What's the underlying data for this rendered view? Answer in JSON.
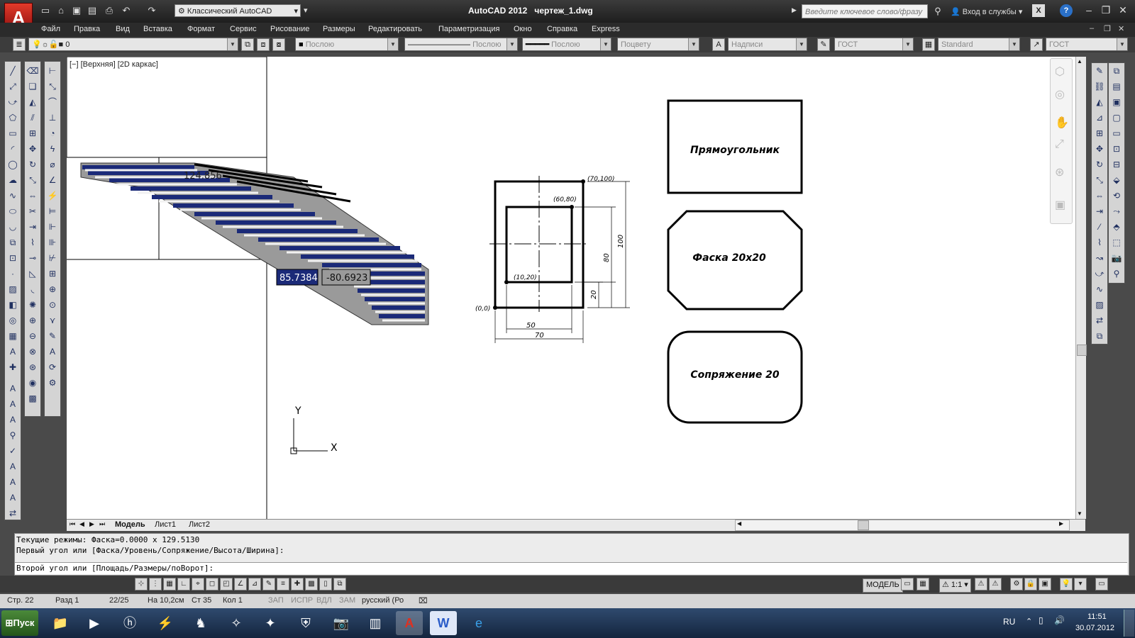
{
  "window": {
    "app_icon": "A",
    "workspace": "Классический AutoCAD",
    "title": "AutoCAD 2012",
    "document": "чертеж_1.dwg",
    "search_placeholder": "Введите ключевое слово/фразу",
    "signin": "Вход в службы"
  },
  "menu": [
    "Файл",
    "Правка",
    "Вид",
    "Вставка",
    "Формат",
    "Сервис",
    "Рисование",
    "Размеры",
    "Редактировать",
    "Параметризация",
    "Окно",
    "Справка",
    "Express"
  ],
  "properties": {
    "layer": "0",
    "color": "Послою",
    "linetype": "Послою",
    "lineweight": "Послою",
    "plotstyle": "Поцвету",
    "text_style_placeholder": "Надписи",
    "dim_style": "ГОСТ",
    "table_style": "Standard",
    "mleader_style": "ГОСТ"
  },
  "viewport_label": "[−] [Верхняя] [2D каркас]",
  "drawing": {
    "shapes": [
      {
        "label": "Прямоугольник"
      },
      {
        "label": "Фаска 20х20"
      },
      {
        "label": "Сопряжение 20"
      }
    ],
    "annotations": {
      "p_outer_top": "(70,100)",
      "p_inner_top": "(60,80)",
      "p_inner_bottom": "(10,20)",
      "p_origin": "(0,0)",
      "dim_100": "100",
      "dim_80": "80",
      "dim_20": "20",
      "dim_50": "50",
      "dim_70": "70"
    },
    "dynamic_input": {
      "value1": "85.7384",
      "value2": "-80.6923",
      "ghost_value": "124.856"
    },
    "ucs": {
      "x_label": "X",
      "y_label": "Y"
    }
  },
  "layout_tabs": [
    "Модель",
    "Лист1",
    "Лист2"
  ],
  "command_line": {
    "line1": "Текущие режимы:  Фаска=0.0000 x 129.5130",
    "line2": "Первый угол или [Фаска/Уровень/Сопряжение/Высота/Ширина]:",
    "line3": "Второй угол или [Площадь/Размеры/поВорот]:"
  },
  "status": {
    "model": "МОДЕЛЬ",
    "scale": "1:1",
    "row": "Стр. 22",
    "section": "Разд 1",
    "pages": "22/25",
    "at": "На 10,2см",
    "col": "Ст 35",
    "kol": "Кол 1",
    "zap": "ЗАП",
    "ispr": "ИСПР",
    "vdl": "ВДЛ",
    "zam": "ЗАМ",
    "lang": "русский (Ро"
  },
  "taskbar": {
    "start": "Пуск",
    "lang": "RU",
    "time": "11:51",
    "date": "30.07.2012"
  },
  "colors": {
    "accent": "#c0201a",
    "dyn_blue": "#1b2a78",
    "canvas": "#ffffff"
  }
}
